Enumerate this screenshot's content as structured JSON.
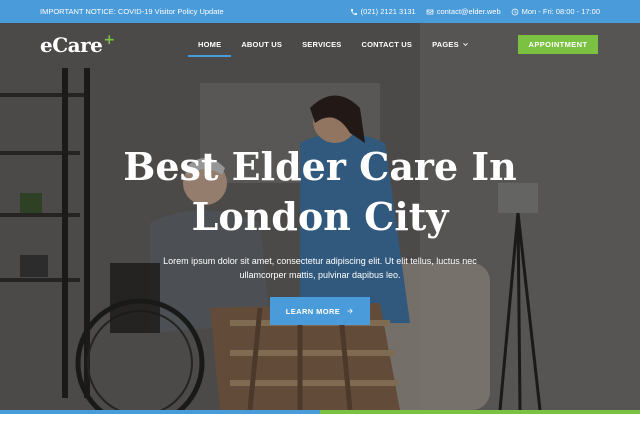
{
  "topbar": {
    "notice": "IMPORTANT NOTICE: COVID-19 Visitor Policy Update",
    "phone": "(021) 2121 3131",
    "email": "contact@elder.web",
    "hours": "Mon - Fri: 08:00 - 17:00"
  },
  "brand": {
    "name": "eCare",
    "mark": "+"
  },
  "nav": {
    "items": [
      {
        "label": "HOME"
      },
      {
        "label": "ABOUT US"
      },
      {
        "label": "SERVICES"
      },
      {
        "label": "CONTACT US"
      },
      {
        "label": "PAGES"
      }
    ],
    "cta_label": "APPOINTMENT"
  },
  "hero": {
    "title_line1": "Best Elder Care In",
    "title_line2": "London City",
    "description": "Lorem ipsum dolor sit amet, consectetur adipiscing elit. Ut elit tellus, luctus nec ullamcorper mattis, pulvinar dapibus leo.",
    "button_label": "LEARN MORE"
  },
  "colors": {
    "primary": "#4a9bd9",
    "accent": "#7bc142",
    "text_on_dark": "#ffffff"
  },
  "icons": {
    "phone": "phone-icon",
    "email": "envelope-icon",
    "hours": "clock-icon",
    "pages_dropdown": "chevron-down-icon",
    "cta_arrow": "arrow-right-icon"
  }
}
